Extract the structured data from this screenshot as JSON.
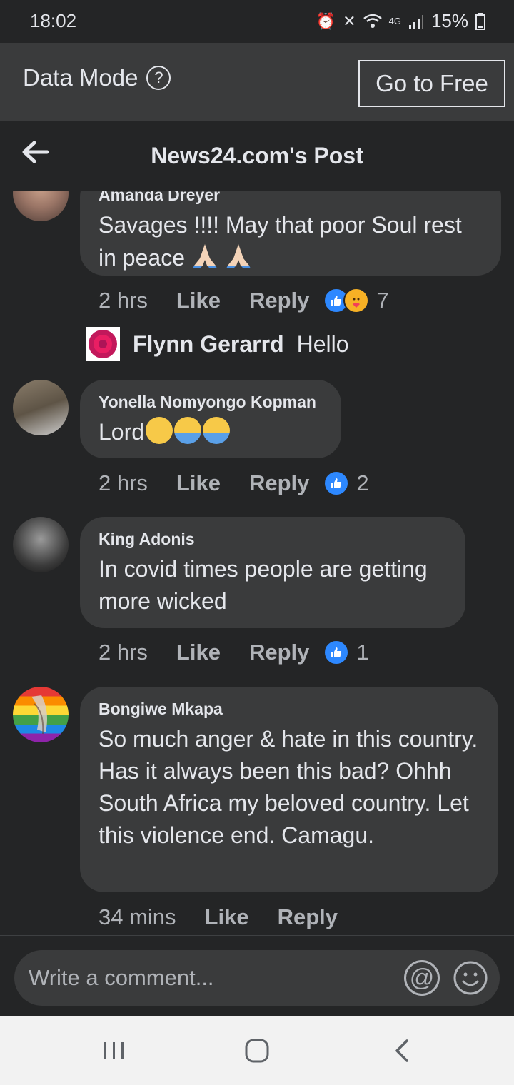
{
  "status_bar": {
    "time": "18:02",
    "network": "4G",
    "battery": "15%"
  },
  "data_mode": {
    "label": "Data Mode",
    "help_icon": "?",
    "go_free_label": "Go to Free"
  },
  "header": {
    "title": "News24.com's Post",
    "back_icon": "arrow-left-icon"
  },
  "comments": [
    {
      "author": "Amanda Dreyer",
      "text": "Savages !!!!  May that poor Soul rest in peace",
      "emoji": "praying-hands x2",
      "time": "2 hrs",
      "like": "Like",
      "reply": "Reply",
      "reactions": [
        "like",
        "care"
      ],
      "reaction_count": "7"
    },
    {
      "author": "Yonella Nomyongo Kopman",
      "text": "Lord",
      "emoji": "sleepy + crying x2",
      "time": "2 hrs",
      "like": "Like",
      "reply": "Reply",
      "reactions": [
        "like"
      ],
      "reaction_count": "2"
    },
    {
      "author": "King Adonis",
      "text": "In covid times people are getting more wicked",
      "time": "2 hrs",
      "like": "Like",
      "reply": "Reply",
      "reactions": [
        "like"
      ],
      "reaction_count": "1"
    },
    {
      "author": "Bongiwe Mkapa",
      "text": "So much anger & hate in this country. Has it always been this bad? Ohhh South Africa my beloved country. Let this violence end. Camagu.",
      "time": "34 mins",
      "like": "Like",
      "reply": "Reply"
    }
  ],
  "reply_preview": {
    "author": "Flynn Gerarrd",
    "text": "Hello"
  },
  "composer": {
    "placeholder": "Write a comment..."
  },
  "colors": {
    "background": "#242526",
    "bubble": "#3a3b3c",
    "like_blue": "#2d88ff",
    "secondary_text": "#b0b3b8"
  }
}
